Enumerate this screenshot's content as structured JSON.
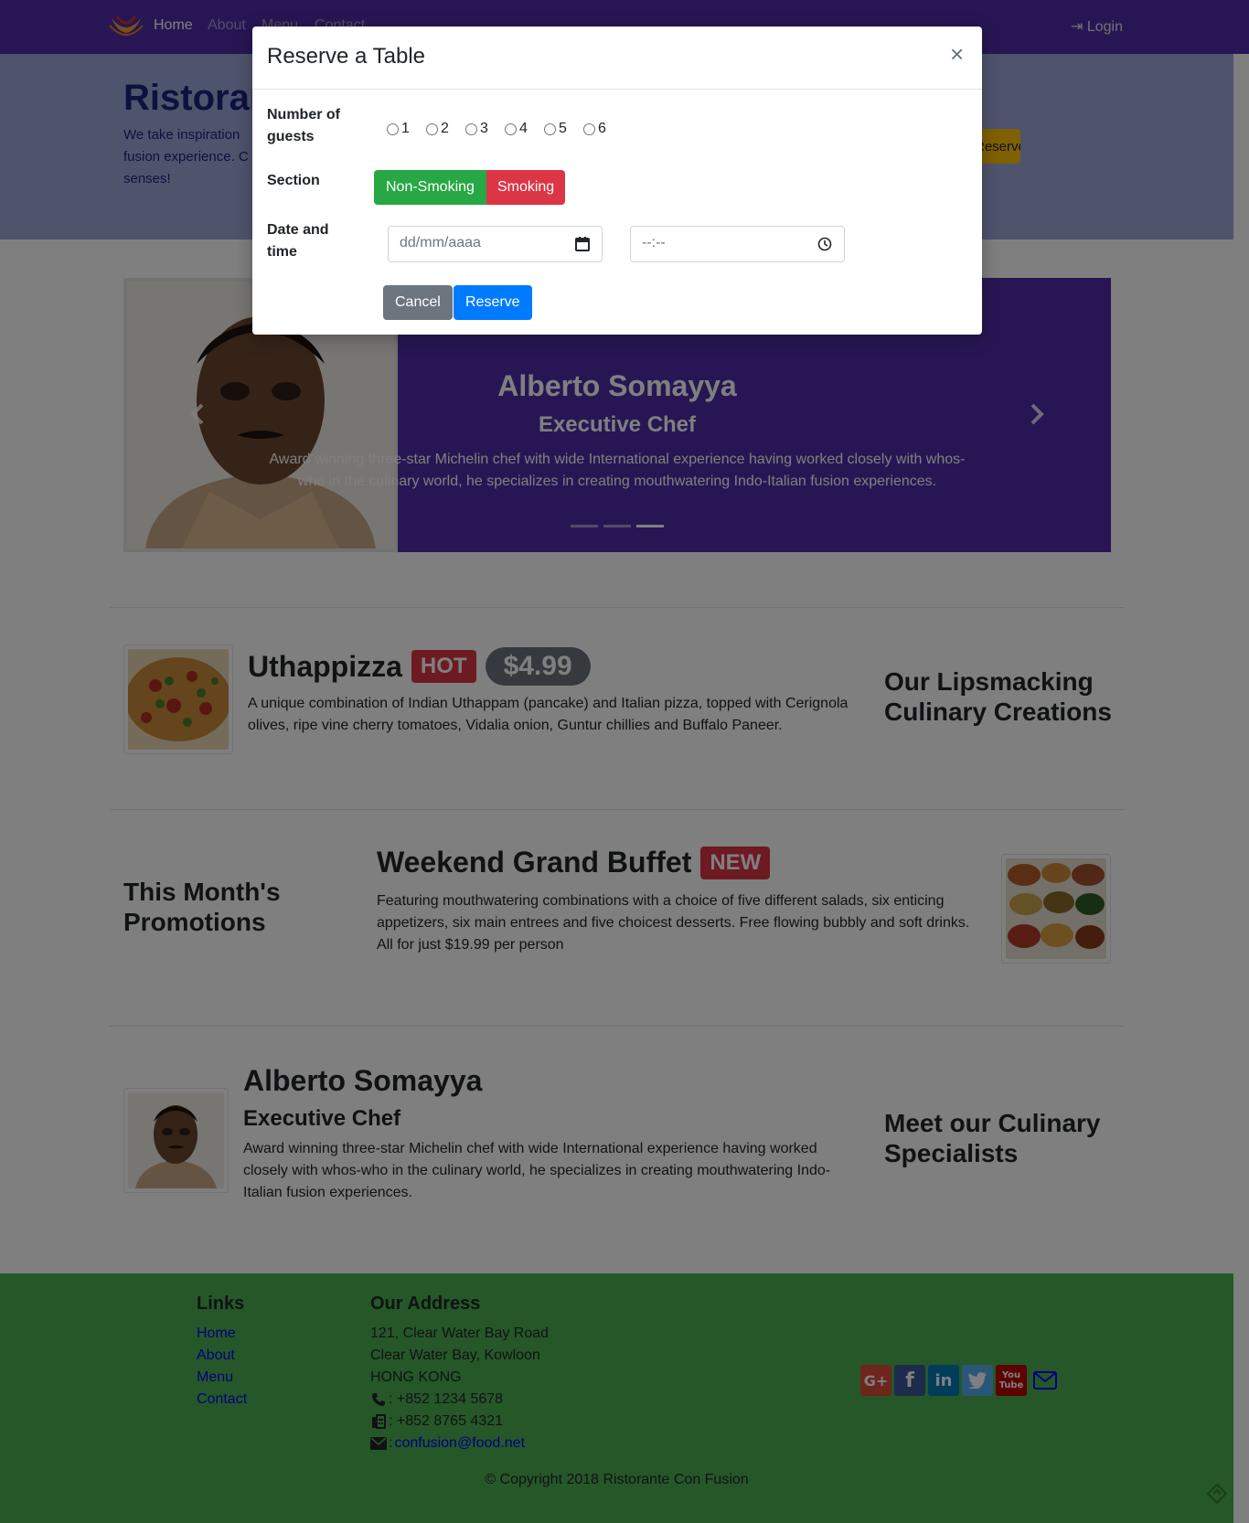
{
  "nav": {
    "home": "Home",
    "about": "About",
    "menu": "Menu",
    "contact": "Contact",
    "login": "Login"
  },
  "jumbotron": {
    "title": "Ristorante con Fusion",
    "text": "We take inspiration fusion experience. C senses!",
    "button": "Reserve Table"
  },
  "carousel": {
    "name": "Alberto Somayya",
    "role": "Executive Chef",
    "description": "Award winning three-star Michelin chef with wide International experience having worked closely with whos-who in the culinary world, he specializes in creating mouthwatering Indo-Italian fusion experiences.",
    "indicator_count": 3,
    "active_indicator": 3
  },
  "dish": {
    "name": "Uthappizza",
    "badge": "HOT",
    "price": "$4.99",
    "description": "A unique combination of Indian Uthappam (pancake) and Italian pizza, topped with Cerignola olives, ripe vine cherry tomatoes, Vidalia onion, Guntur chillies and Buffalo Paneer.",
    "section": "Our Lipsmacking Culinary Creations"
  },
  "promotion": {
    "section": "This Month's Promotions",
    "name": "Weekend Grand Buffet",
    "badge": "NEW",
    "description": "Featuring mouthwatering combinations with a choice of five different salads, six enticing appetizers, six main entrees and five choicest desserts. Free flowing bubbly and soft drinks. All for just $19.99 per person"
  },
  "leader": {
    "name": "Alberto Somayya",
    "role": "Executive Chef",
    "description": "Award winning three-star Michelin chef with wide International experience having worked closely with whos-who in the culinary world, he specializes in creating mouthwatering Indo-Italian fusion experiences.",
    "section": "Meet our Culinary Specialists"
  },
  "footer": {
    "links_heading": "Links",
    "links": [
      "Home",
      "About",
      "Menu",
      "Contact"
    ],
    "address_heading": "Our Address",
    "address_line1": "121, Clear Water Bay Road",
    "address_line2": "Clear Water Bay, Kowloon",
    "address_line3": "HONG KONG",
    "phone": ": +852 1234 5678",
    "fax": ": +852 8765 4321",
    "email_prefix": ":",
    "email": "confusion@food.net",
    "social": [
      "google-plus-icon",
      "facebook-icon",
      "linkedin-icon",
      "twitter-icon",
      "youtube-icon",
      "envelope-icon"
    ],
    "copyright": "© Copyright 2018 Ristorante Con Fusion"
  },
  "modal": {
    "title": "Reserve a Table",
    "close": "×",
    "guests_label": "Number of guests",
    "guest_options": [
      "1",
      "2",
      "3",
      "4",
      "5",
      "6"
    ],
    "section_label": "Section",
    "non_smoking": "Non-Smoking",
    "smoking": "Smoking",
    "datetime_label": "Date and time",
    "date_placeholder": "dd/mm/aaaa",
    "time_placeholder": "--:--",
    "cancel": "Cancel",
    "reserve": "Reserve"
  },
  "colors": {
    "primary_purple": "#512DA8",
    "jumbotron": "#9FA8DA",
    "footer": "#4CAF50",
    "success": "#28a745",
    "danger": "#dc3545",
    "primary": "#007bff",
    "secondary": "#6c757d",
    "warning": "#FFC107"
  }
}
